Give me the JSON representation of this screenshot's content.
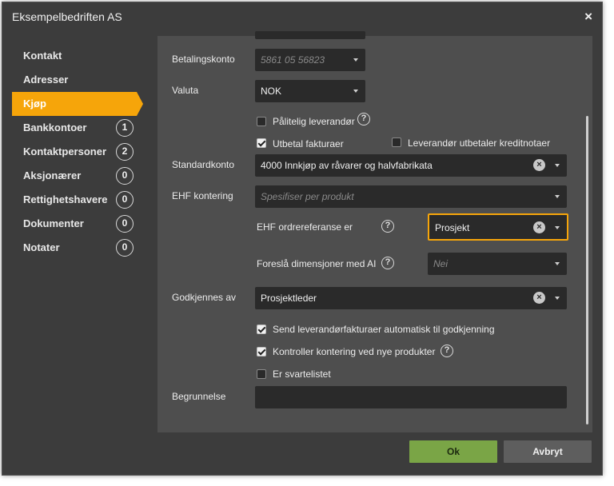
{
  "dialog": {
    "title": "Eksempelbedriften AS",
    "close_glyph": "×"
  },
  "nav": {
    "items": [
      {
        "label": "Kontakt",
        "badge": ""
      },
      {
        "label": "Adresser",
        "badge": ""
      },
      {
        "label": "Kjøp",
        "badge": "",
        "active": true
      },
      {
        "label": "Bankkontoer",
        "badge": "1"
      },
      {
        "label": "Kontaktpersoner",
        "badge": "2"
      },
      {
        "label": "Aksjonærer",
        "badge": "0"
      },
      {
        "label": "Rettighetshavere",
        "badge": "0"
      },
      {
        "label": "Dokumenter",
        "badge": "0"
      },
      {
        "label": "Notater",
        "badge": "0"
      }
    ]
  },
  "form": {
    "betalingskonto": {
      "label": "Betalingskonto",
      "value": "5861 05 56823"
    },
    "valuta": {
      "label": "Valuta",
      "value": "NOK"
    },
    "palitelig": {
      "label": "Pålitelig leverandør",
      "checked": false
    },
    "utbetal": {
      "label": "Utbetal fakturaer",
      "checked": true
    },
    "kreditnotaer": {
      "label": "Leverandør utbetaler kreditnotaer",
      "checked": false
    },
    "standardkonto": {
      "label": "Standardkonto",
      "value": "4000 Innkjøp av råvarer og halvfabrikata"
    },
    "ehf_kontering": {
      "label": "EHF kontering",
      "placeholder": "Spesifiser per produkt"
    },
    "ehf_ordre": {
      "label": "EHF ordrereferanse er",
      "value": "Prosjekt"
    },
    "dimensjoner": {
      "label": "Foreslå dimensjoner med AI",
      "value": "Nei"
    },
    "godkjennes": {
      "label": "Godkjennes av",
      "value": "Prosjektleder"
    },
    "send_auto": {
      "label": "Send leverandørfakturaer automatisk til godkjenning",
      "checked": true
    },
    "kontroller": {
      "label": "Kontroller kontering ved nye produkter",
      "checked": true
    },
    "svarteliste": {
      "label": "Er svartelistet",
      "checked": false
    },
    "begrunnelse": {
      "label": "Begrunnelse",
      "value": ""
    },
    "help_glyph": "?",
    "clear_glyph": "×"
  },
  "footer": {
    "ok_label": "Ok",
    "cancel_label": "Avbryt"
  },
  "colors": {
    "accent": "#f6a50a",
    "ok_button": "#7aa546",
    "panel": "#4e4e4e",
    "dialog": "#3c3c3c",
    "field": "#2a2a2a"
  }
}
